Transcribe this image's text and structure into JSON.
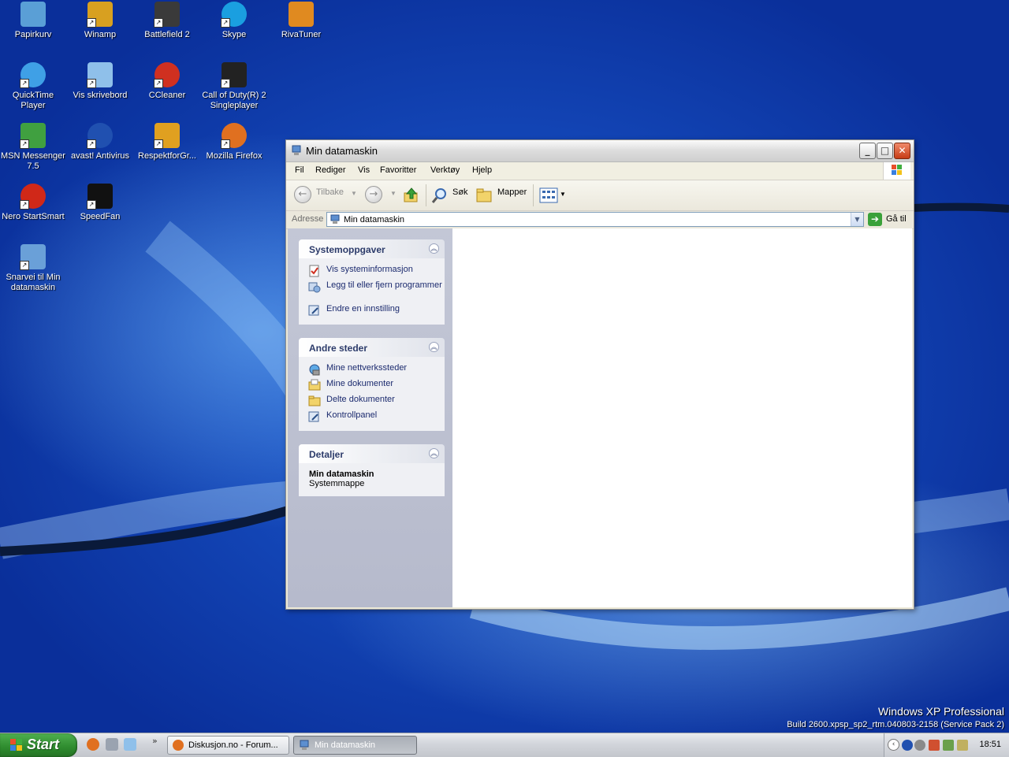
{
  "desktop": {
    "icons": [
      {
        "label": "Papirkurv",
        "icon": "recycle-bin-icon",
        "color": "#5a9fd6"
      },
      {
        "label": "Winamp",
        "icon": "winamp-icon",
        "color": "#d8a020"
      },
      {
        "label": "Battlefield 2",
        "icon": "battlefield-icon",
        "color": "#3a3a3a"
      },
      {
        "label": "Skype",
        "icon": "skype-icon",
        "color": "#1a9fe0"
      },
      {
        "label": "RivaTuner",
        "icon": "rivatuner-icon",
        "color": "#e08a20"
      },
      {
        "label": "QuickTime Player",
        "icon": "quicktime-icon",
        "color": "#3fa0e6"
      },
      {
        "label": "Vis skrivebord",
        "icon": "show-desktop-icon",
        "color": "#8fc0ea"
      },
      {
        "label": "CCleaner",
        "icon": "ccleaner-icon",
        "color": "#d03020"
      },
      {
        "label": "Call of Duty(R) 2 Singleplayer",
        "icon": "call-of-duty-icon",
        "color": "#222222"
      },
      {
        "label": "MSN Messenger 7.5",
        "icon": "msn-messenger-icon",
        "color": "#40a040"
      },
      {
        "label": "avast! Antivirus",
        "icon": "avast-icon",
        "color": "#2050b0"
      },
      {
        "label": "RespektforGr...",
        "icon": "respekt-icon",
        "color": "#e0a020"
      },
      {
        "label": "Mozilla Firefox",
        "icon": "firefox-icon",
        "color": "#e07020"
      },
      {
        "label": "Nero StartSmart",
        "icon": "nero-icon",
        "color": "#d02818"
      },
      {
        "label": "SpeedFan",
        "icon": "speedfan-icon",
        "color": "#111111"
      },
      {
        "label": "Snarvei til Min datamaskin",
        "icon": "my-computer-shortcut-icon",
        "color": "#6aa0d8"
      }
    ]
  },
  "window": {
    "title": "Min datamaskin",
    "menu": [
      "Fil",
      "Rediger",
      "Vis",
      "Favoritter",
      "Verktøy",
      "Hjelp"
    ],
    "toolbar": {
      "back": "Tilbake",
      "search": "Søk",
      "folders": "Mapper"
    },
    "address": {
      "label": "Adresse",
      "value": "Min datamaskin",
      "go": "Gå til"
    },
    "taskpane": {
      "system_tasks": {
        "title": "Systemoppgaver",
        "items": [
          "Vis systeminformasjon",
          "Legg til eller fjern programmer",
          "Endre en innstilling"
        ]
      },
      "other_places": {
        "title": "Andre steder",
        "items": [
          "Mine nettverkssteder",
          "Mine dokumenter",
          "Delte dokumenter",
          "Kontrollpanel"
        ]
      },
      "details": {
        "title": "Detaljer",
        "name": "Min datamaskin",
        "type": "Systemmappe"
      }
    }
  },
  "watermark": {
    "edition": "Windows XP Professional",
    "build": "Build 2600.xpsp_sp2_rtm.040803-2158 (Service Pack 2)"
  },
  "taskbar": {
    "start": "Start",
    "tasks": [
      "Diskusjon.no - Forum...",
      "Min datamaskin"
    ],
    "clock": "18:51"
  },
  "colors": {
    "desktop": "#1d5fd6",
    "start": "#2e8b2e",
    "link": "#1b2a6e"
  }
}
